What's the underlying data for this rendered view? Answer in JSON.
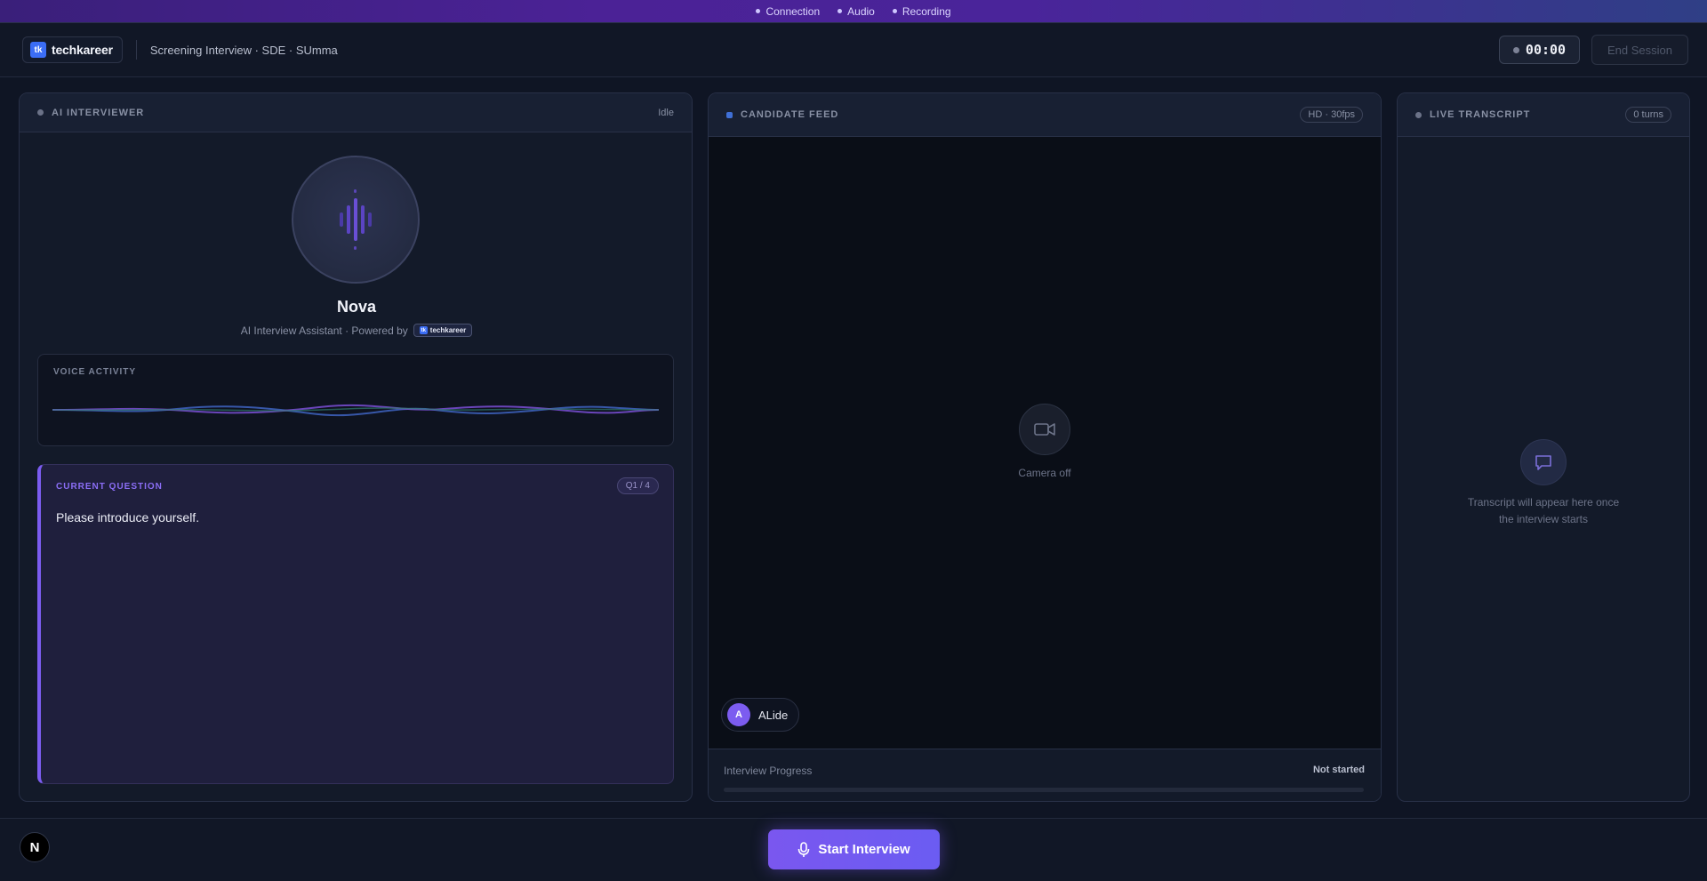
{
  "status_strip": {
    "items": [
      "Connection",
      "Audio",
      "Recording"
    ]
  },
  "header": {
    "brand": "techkareer",
    "brand_mark": "tk",
    "session_title": "Screening Interview · SDE · SUmma",
    "timer": "00:00",
    "end_session_label": "End Session"
  },
  "ai_panel": {
    "title": "AI INTERVIEWER",
    "state": "Idle",
    "assistant_name": "Nova",
    "assistant_sub": "AI Interview Assistant · Powered by",
    "powered_brand": "techkareer",
    "voice_activity_label": "VOICE ACTIVITY",
    "current_question_label": "CURRENT QUESTION",
    "question_counter": "Q1 / 4",
    "question_text": "Please introduce yourself."
  },
  "candidate_panel": {
    "title": "CANDIDATE FEED",
    "quality_badge": "HD · 30fps",
    "camera_status": "Camera off",
    "candidate_initial": "A",
    "candidate_name": "ALide",
    "progress_label": "Interview Progress",
    "progress_status": "Not started",
    "progress_fraction": 0
  },
  "transcript_panel": {
    "title": "LIVE TRANSCRIPT",
    "turns_badge": "0 turns",
    "empty_line1": "Transcript will appear here once",
    "empty_line2": "the interview starts"
  },
  "footer": {
    "n_badge": "N",
    "start_label": "Start Interview"
  },
  "icons": {
    "waveform": "waveform-icon",
    "camera": "video-camera-icon",
    "chat": "chat-bubble-icon",
    "mic": "microphone-icon"
  },
  "colors": {
    "accent": "#7b5cf0",
    "brand_blue": "#3b6df5",
    "background": "#0f1524"
  }
}
